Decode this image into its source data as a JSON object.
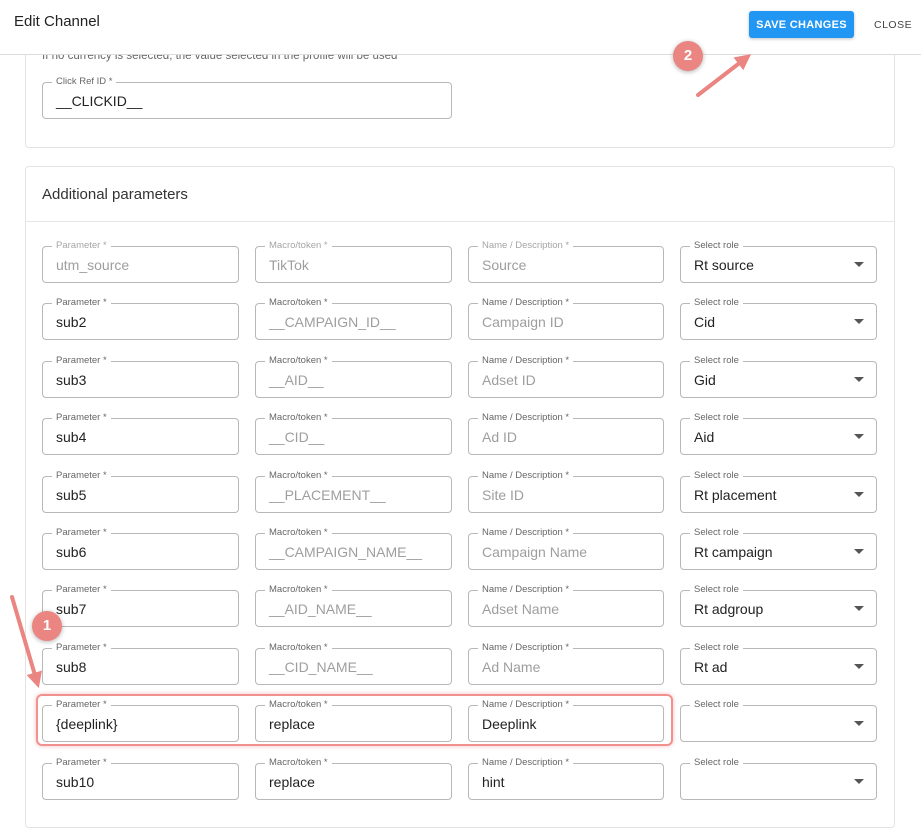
{
  "header": {
    "title": "Edit Channel",
    "save_label": "SAVE CHANGES",
    "close_label": "CLOSE"
  },
  "top_card": {
    "hint": "If no currency is selected, the value selected in the profile will be used",
    "click_ref": {
      "label": "Click Ref ID *",
      "value": "__CLICKID__"
    }
  },
  "additional": {
    "title": "Additional parameters",
    "rows": [
      {
        "param_label": "Parameter *",
        "param": "utm_source",
        "macro_label": "Macro/token *",
        "macro": "TikTok",
        "name_label": "Name / Description *",
        "name": "Source",
        "role_label": "Select role",
        "role": "Rt source"
      },
      {
        "param_label": "Parameter *",
        "param": "sub2",
        "macro_label": "Macro/token *",
        "macro": "__CAMPAIGN_ID__",
        "name_label": "Name / Description *",
        "name": "Campaign ID",
        "role_label": "Select role",
        "role": "Cid"
      },
      {
        "param_label": "Parameter *",
        "param": "sub3",
        "macro_label": "Macro/token *",
        "macro": "__AID__",
        "name_label": "Name / Description *",
        "name": "Adset ID",
        "role_label": "Select role",
        "role": "Gid"
      },
      {
        "param_label": "Parameter *",
        "param": "sub4",
        "macro_label": "Macro/token *",
        "macro": "__CID__",
        "name_label": "Name / Description *",
        "name": "Ad ID",
        "role_label": "Select role",
        "role": "Aid"
      },
      {
        "param_label": "Parameter *",
        "param": "sub5",
        "macro_label": "Macro/token *",
        "macro": "__PLACEMENT__",
        "name_label": "Name / Description *",
        "name": "Site ID",
        "role_label": "Select role",
        "role": "Rt placement"
      },
      {
        "param_label": "Parameter *",
        "param": "sub6",
        "macro_label": "Macro/token *",
        "macro": "__CAMPAIGN_NAME__",
        "name_label": "Name / Description *",
        "name": "Campaign Name",
        "role_label": "Select role",
        "role": "Rt campaign"
      },
      {
        "param_label": "Parameter *",
        "param": "sub7",
        "macro_label": "Macro/token *",
        "macro": "__AID_NAME__",
        "name_label": "Name / Description *",
        "name": "Adset Name",
        "role_label": "Select role",
        "role": "Rt adgroup"
      },
      {
        "param_label": "Parameter *",
        "param": "sub8",
        "macro_label": "Macro/token *",
        "macro": "__CID_NAME__",
        "name_label": "Name / Description *",
        "name": "Ad Name",
        "role_label": "Select role",
        "role": "Rt ad"
      },
      {
        "param_label": "Parameter *",
        "param": "{deeplink}",
        "macro_label": "Macro/token *",
        "macro": "replace",
        "name_label": "Name / Description *",
        "name": "Deeplink",
        "role_label": "Select role",
        "role": ""
      },
      {
        "param_label": "Parameter *",
        "param": "sub10",
        "macro_label": "Macro/token *",
        "macro": "replace",
        "name_label": "Name / Description *",
        "name": "hint",
        "role_label": "Select role",
        "role": ""
      }
    ]
  },
  "annotations": {
    "step1": "1",
    "step2": "2"
  },
  "colors": {
    "primary": "#2196f3",
    "annotation": "#ea8582",
    "highlight_border": "#f0908f"
  }
}
